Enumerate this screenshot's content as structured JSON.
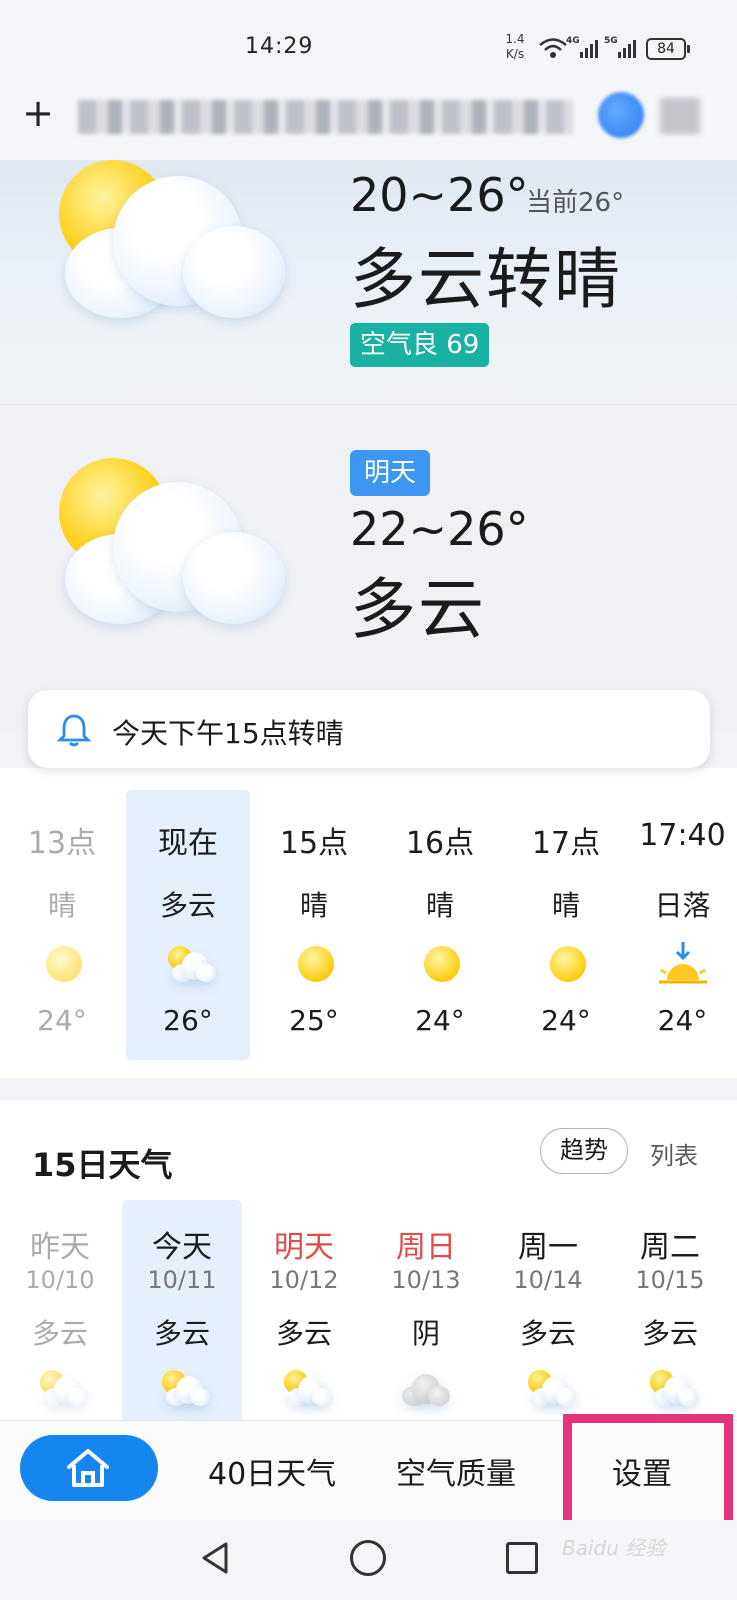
{
  "status_bar": {
    "time": "14:29",
    "net_speed_value": "1.4",
    "net_speed_unit": "K/s",
    "sig1_label": "4G",
    "sig2_label": "5G",
    "battery": "84"
  },
  "today": {
    "temp_range": "20~26°",
    "current_temp": "当前26°",
    "description": "多云转晴",
    "air_quality": "空气良 69"
  },
  "tomorrow": {
    "badge": "明天",
    "temp_range": "22~26°",
    "description": "多云"
  },
  "alert": {
    "text": "今天下午15点转晴"
  },
  "hourly": [
    {
      "time": "13点",
      "condition": "晴",
      "temp": "24°",
      "icon": "sun-icon"
    },
    {
      "time": "现在",
      "condition": "多云",
      "temp": "26°",
      "icon": "partly-cloudy-icon"
    },
    {
      "time": "15点",
      "condition": "晴",
      "temp": "25°",
      "icon": "sun-icon"
    },
    {
      "time": "16点",
      "condition": "晴",
      "temp": "24°",
      "icon": "sun-icon"
    },
    {
      "time": "17点",
      "condition": "晴",
      "temp": "24°",
      "icon": "sun-icon"
    },
    {
      "time": "17:40",
      "condition": "日落",
      "temp": "24°",
      "icon": "sunset-icon"
    }
  ],
  "daily": {
    "title": "15日天气",
    "trend_label": "趋势",
    "list_label": "列表",
    "days": [
      {
        "name": "昨天",
        "date": "10/10",
        "condition": "多云",
        "icon": "partly-cloudy-icon"
      },
      {
        "name": "今天",
        "date": "10/11",
        "condition": "多云",
        "icon": "partly-cloudy-icon"
      },
      {
        "name": "明天",
        "date": "10/12",
        "condition": "多云",
        "icon": "partly-cloudy-icon"
      },
      {
        "name": "周日",
        "date": "10/13",
        "condition": "阴",
        "icon": "overcast-icon"
      },
      {
        "name": "周一",
        "date": "10/14",
        "condition": "多云",
        "icon": "partly-cloudy-icon"
      },
      {
        "name": "周二",
        "date": "10/15",
        "condition": "多云",
        "icon": "partly-cloudy-icon"
      }
    ]
  },
  "bottom_nav": {
    "items": [
      "40日天气",
      "空气质量",
      "设置"
    ]
  },
  "watermark": "Baidu 经验",
  "colors": {
    "accent": "#1586f0",
    "aqi_good": "#19b1a3",
    "tomorrow_badge": "#3d97f2",
    "weekend_red": "#e14a4a",
    "highlight": "#e3337a"
  }
}
